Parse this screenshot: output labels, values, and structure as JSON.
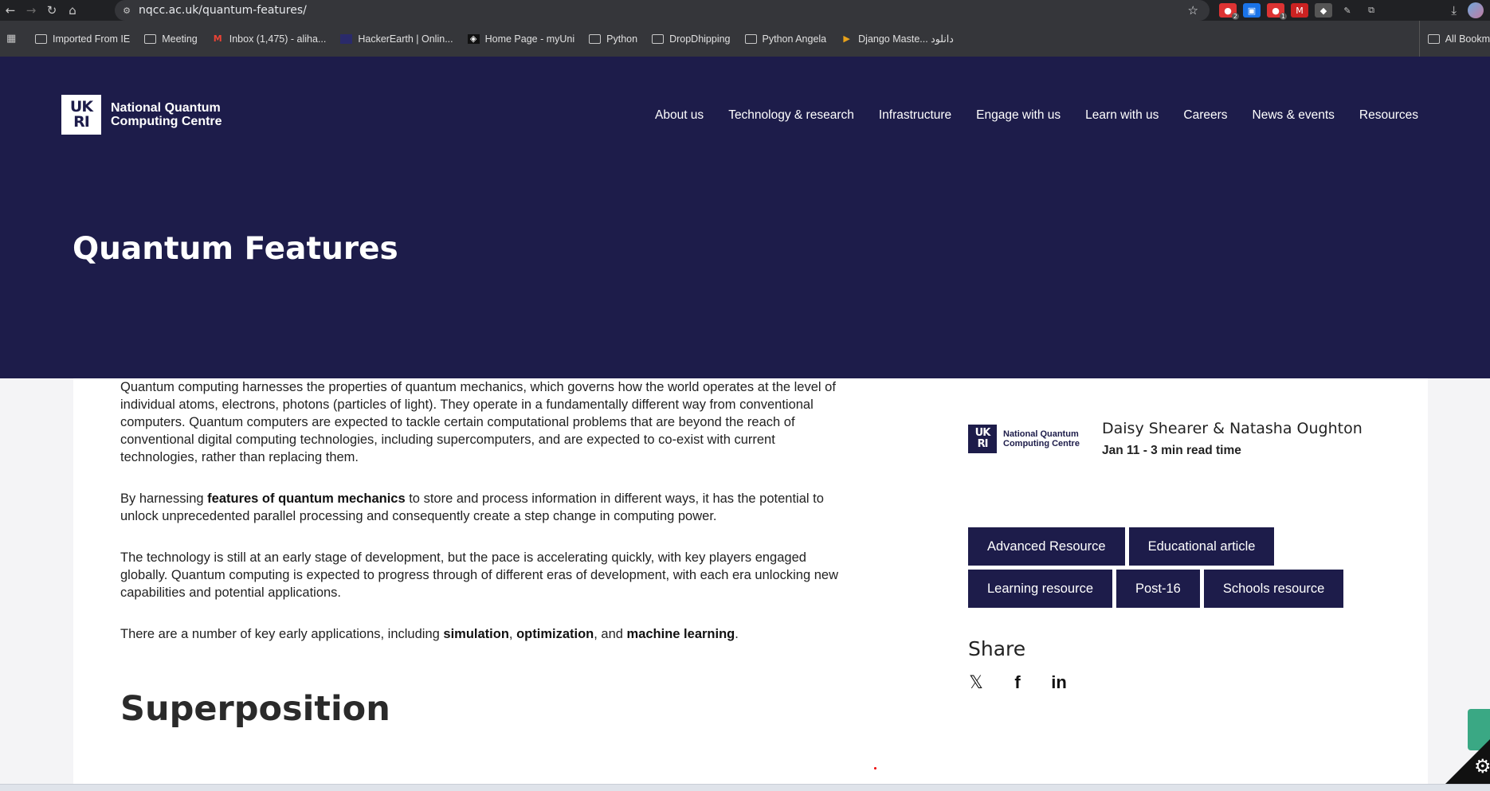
{
  "browser": {
    "url": "nqcc.ac.uk/quantum-features/",
    "bookmarks": [
      {
        "label": "Imported From IE",
        "icon": "folder-icon"
      },
      {
        "label": "Meeting",
        "icon": "folder-icon"
      },
      {
        "label": "Inbox (1,475) - aliha...",
        "icon": "gmail-icon"
      },
      {
        "label": "HackerEarth | Onlin...",
        "icon": "hackerearth-icon"
      },
      {
        "label": "Home Page - myUni",
        "icon": "myuni-icon"
      },
      {
        "label": "Python",
        "icon": "folder-icon"
      },
      {
        "label": "DropDhipping",
        "icon": "folder-icon"
      },
      {
        "label": "Python Angela",
        "icon": "folder-icon"
      },
      {
        "label": "Django Maste... دانلود",
        "icon": "django-icon"
      }
    ],
    "all_bookmarks": "All Bookm",
    "extension_badges": [
      "2",
      "1"
    ]
  },
  "site": {
    "logo_line1": "National Quantum",
    "logo_line2": "Computing Centre",
    "nav": [
      "About us",
      "Technology & research",
      "Infrastructure",
      "Engage with us",
      "Learn with us",
      "Careers",
      "News & events",
      "Resources"
    ],
    "page_title": "Quantum Features"
  },
  "article": {
    "p1": "Quantum computing harnesses the properties of quantum mechanics, which governs how the world operates at the level of individual atoms, electrons, photons (particles of light). They operate in a fundamentally different way from conventional computers. Quantum computers are expected to tackle certain computational problems that are beyond the reach of conventional digital computing technologies, including supercomputers, and are expected to co-exist with current technologies, rather than replacing them.",
    "p2_a": "By harnessing ",
    "p2_b": "features of quantum mechanics",
    "p2_c": " to store and process information in different ways, it has the potential to unlock unprecedented parallel processing and consequently create a step change in computing power.",
    "p3": "The technology is still at an early stage of development, but the pace is accelerating quickly, with key players engaged globally. Quantum computing is expected to progress through of different eras of development, with each era unlocking new capabilities and potential applications.",
    "p4_a": "There are a number of key early applications, including ",
    "p4_b": "simulation",
    "p4_c": ", ",
    "p4_d": "optimization",
    "p4_e": ", and ",
    "p4_f": "machine learning",
    "p4_g": ".",
    "heading": "Superposition"
  },
  "sidebar": {
    "author": "Daisy Shearer & Natasha Oughton",
    "meta": "Jan 11 - 3 min read time",
    "tags": [
      "Advanced Resource",
      "Educational article",
      "Learning resource",
      "Post-16",
      "Schools resource"
    ],
    "share_title": "Share",
    "share_icons": [
      "x-icon",
      "facebook-icon",
      "linkedin-icon"
    ]
  },
  "colors": {
    "brand_navy": "#1d1c4a",
    "accessibility_green": "#3aa884"
  }
}
